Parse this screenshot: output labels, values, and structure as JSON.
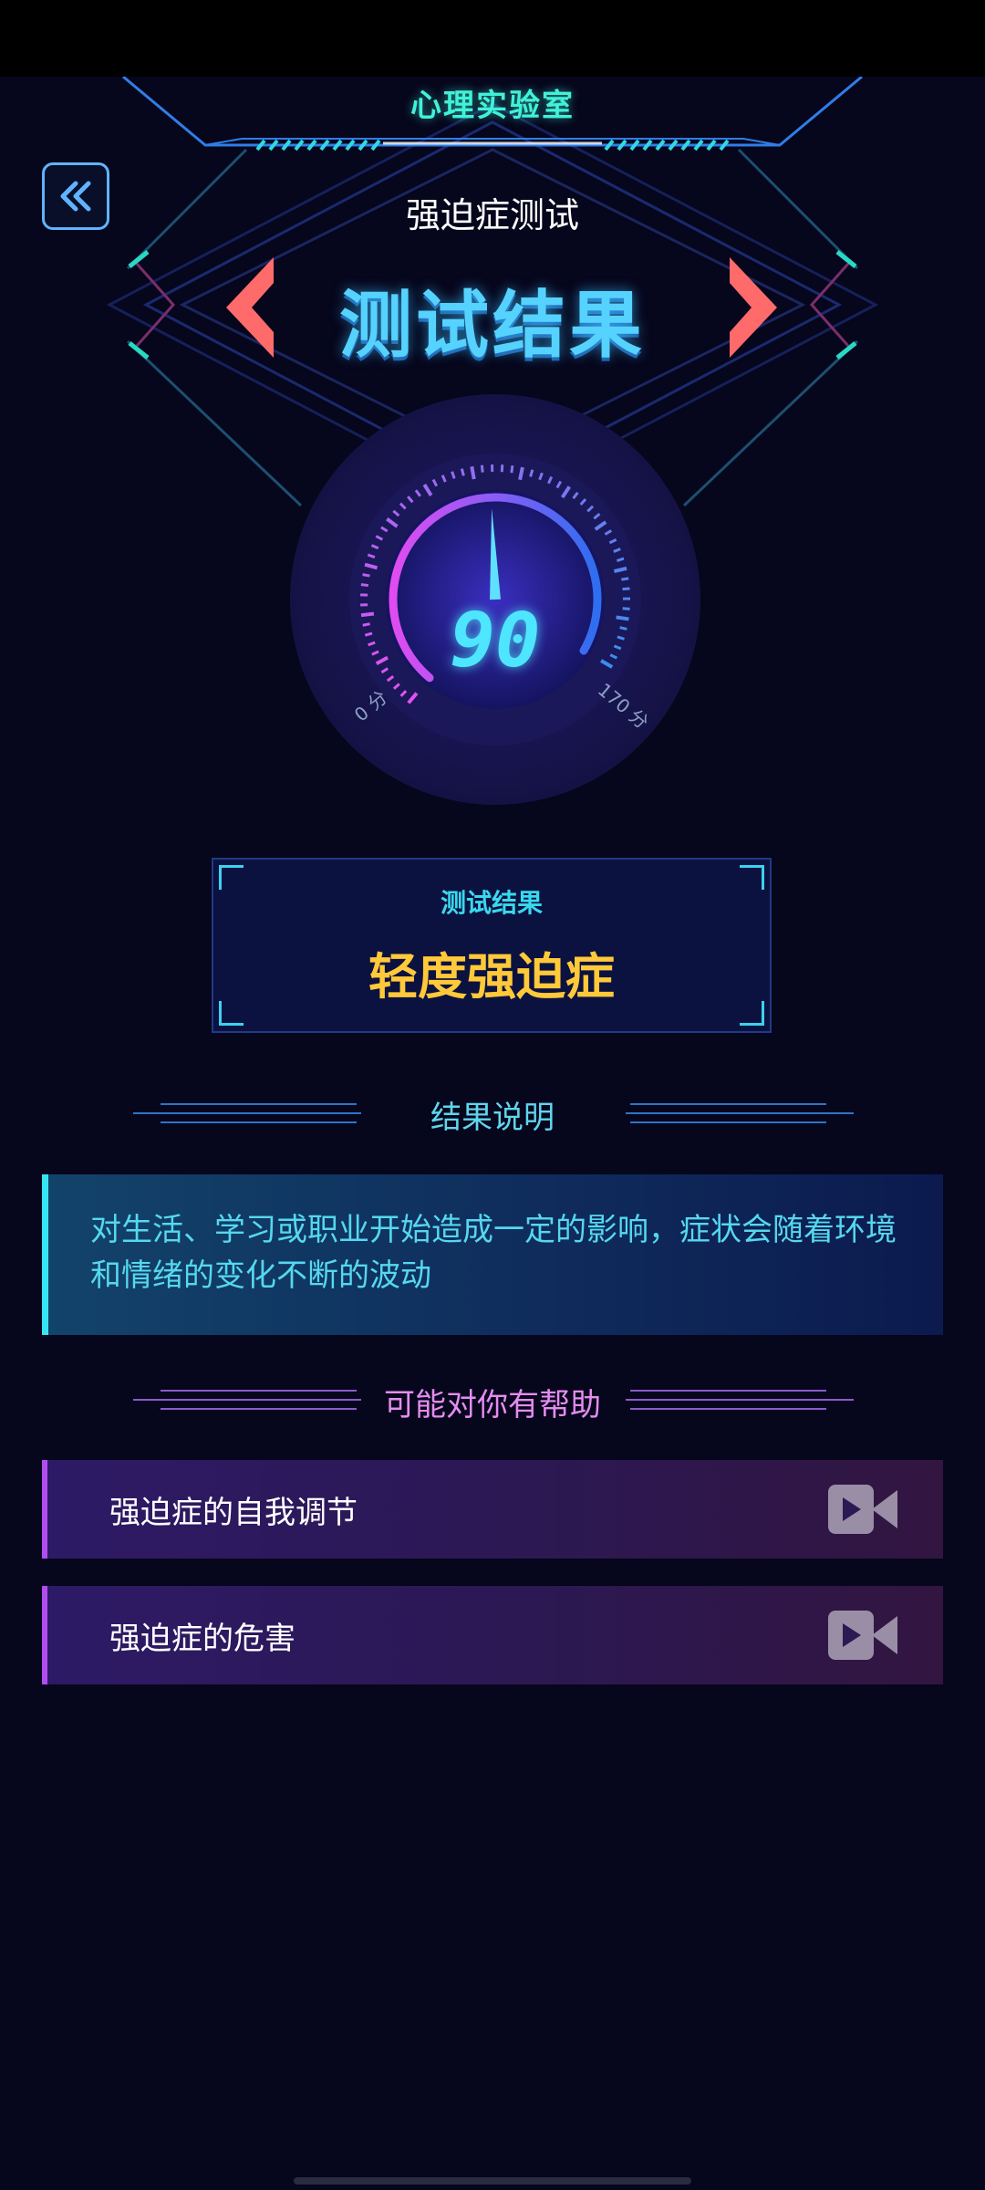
{
  "header": {
    "app_title": "心理实验室",
    "test_name": "强迫症测试",
    "banner": "测试结果"
  },
  "gauge": {
    "score": "90",
    "min_label": "0 分",
    "max_label": "170 分",
    "level": 0.53
  },
  "result_box": {
    "label": "测试结果",
    "value": "轻度强迫症"
  },
  "explanation": {
    "heading": "结果说明",
    "text": "对生活、学习或职业开始造成一定的影响，症状会随着环境和情绪的变化不断的波动"
  },
  "help": {
    "heading": "可能对你有帮助",
    "items": [
      {
        "label": "强迫症的自我调节",
        "icon": "video-camera-icon"
      },
      {
        "label": "强迫症的危害",
        "icon": "video-camera-icon"
      }
    ]
  },
  "colors": {
    "background": "#06061c",
    "accent_cyan": "#3ff2d8",
    "result_yellow": "#ffc93a",
    "help_pink": "#e58cf0",
    "arrow_coral": "#ff6a6a"
  }
}
